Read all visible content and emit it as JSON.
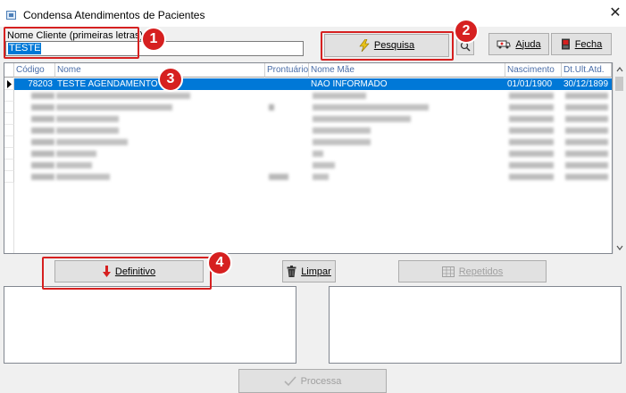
{
  "window": {
    "title": "Condensa Atendimentos de Pacientes"
  },
  "search": {
    "label": "Nome Cliente  (primeiras letras)",
    "value": "TESTE",
    "pesquisa_label": "Pesquisa",
    "ajuda_label": "Ajuda",
    "fecha_label": "Fecha"
  },
  "table": {
    "columns": [
      "Código",
      "Nome",
      "Prontuário",
      "Nome Mãe",
      "Nascimento",
      "Dt.Ult.Atd."
    ],
    "rows": [
      {
        "codigo": "78203",
        "nome": "TESTE AGENDAMENTO",
        "prontuario": "",
        "nome_mae": "NAO INFORMADO",
        "nascimento": "01/01/1900",
        "dt_ult_atd": "30/12/1899"
      }
    ]
  },
  "actions": {
    "definitivo_label": "Definitivo",
    "limpar_label": "Limpar",
    "repetidos_label": "Repetidos",
    "processa_label": "Processa"
  },
  "annotations": [
    "1",
    "2",
    "3",
    "4"
  ],
  "colors": {
    "selection": "#0078d7",
    "callout": "#d62020"
  }
}
